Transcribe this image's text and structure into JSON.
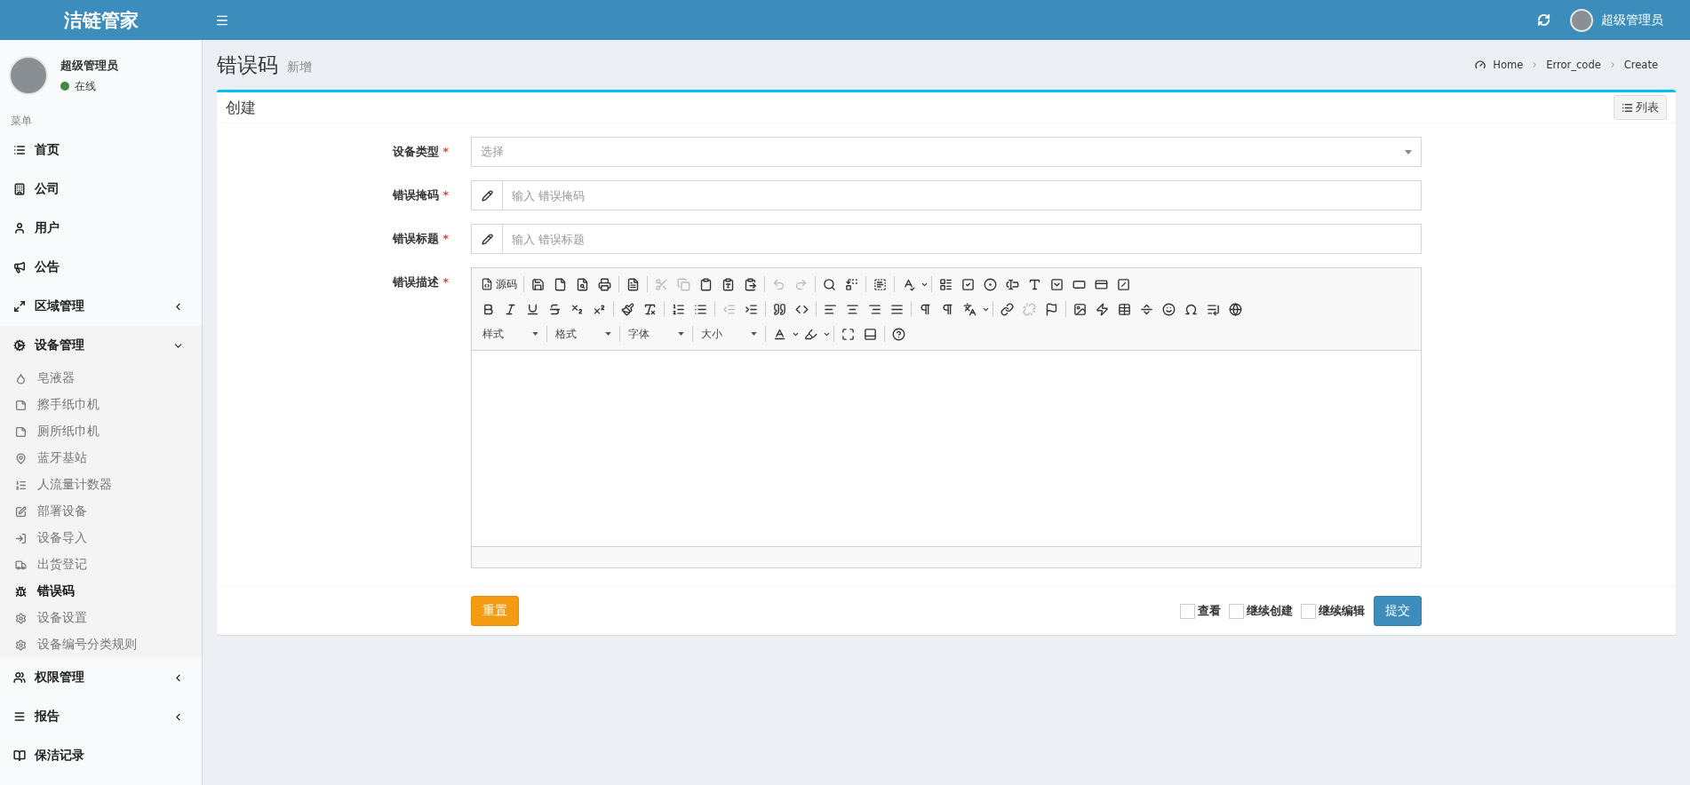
{
  "header": {
    "brand": "洁链管家",
    "user_name": "超级管理员"
  },
  "sidebar": {
    "user": {
      "name": "超级管理员",
      "status": "在线",
      "online": true
    },
    "menu_label": "菜单",
    "items": [
      {
        "kind": "link",
        "label": "首页"
      },
      {
        "kind": "link",
        "label": "公司"
      },
      {
        "kind": "link",
        "label": "用户"
      },
      {
        "kind": "link",
        "label": "公告"
      },
      {
        "kind": "group",
        "label": "区域管理",
        "expanded": false
      },
      {
        "kind": "group",
        "label": "设备管理",
        "expanded": true,
        "children": [
          {
            "label": "皂液器",
            "selected": false
          },
          {
            "label": "擦手纸巾机",
            "selected": false
          },
          {
            "label": "厕所纸巾机",
            "selected": false
          },
          {
            "label": "蓝牙基站",
            "selected": false
          },
          {
            "label": "人流量计数器",
            "selected": false
          },
          {
            "label": "部署设备",
            "selected": false
          },
          {
            "label": "设备导入",
            "selected": false
          },
          {
            "label": "出货登记",
            "selected": false
          },
          {
            "label": "错误码",
            "selected": true
          },
          {
            "label": "设备设置",
            "selected": false
          },
          {
            "label": "设备编号分类规则",
            "selected": false
          }
        ]
      },
      {
        "kind": "group",
        "label": "权限管理",
        "expanded": false
      },
      {
        "kind": "group",
        "label": "报告",
        "expanded": false
      },
      {
        "kind": "link",
        "label": "保洁记录"
      }
    ]
  },
  "page": {
    "title": "错误码",
    "subtitle": "新增",
    "breadcrumb": [
      "Home",
      "Error_code",
      "Create"
    ]
  },
  "box": {
    "title": "创建",
    "list_button": "列表"
  },
  "form": {
    "required_mark": "*",
    "fields": [
      {
        "kind": "select",
        "label": "设备类型",
        "required": true,
        "placeholder": "选择"
      },
      {
        "kind": "input",
        "label": "错误掩码",
        "required": true,
        "placeholder": "输入 错误掩码"
      },
      {
        "kind": "input",
        "label": "错误标题",
        "required": true,
        "placeholder": "输入 错误标题"
      },
      {
        "kind": "editor",
        "label": "错误描述",
        "required": true
      }
    ]
  },
  "editor": {
    "source_label": "源码",
    "dropdowns": [
      "样式",
      "格式",
      "字体",
      "大小"
    ]
  },
  "footer": {
    "reset": "重置",
    "options": [
      {
        "label": "查看",
        "checked": false
      },
      {
        "label": "继续创建",
        "checked": false
      },
      {
        "label": "继续编辑",
        "checked": false
      }
    ],
    "submit": "提交"
  }
}
